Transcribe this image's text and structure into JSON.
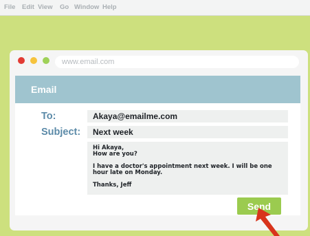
{
  "menubar": {
    "items": [
      "File",
      "Edit",
      "View",
      "Go",
      "Window",
      "Help"
    ]
  },
  "browser": {
    "url": "www.email.com"
  },
  "email": {
    "header_title": "Email",
    "to_label": "To:",
    "to_value": "Akaya@emailme.com",
    "subject_label": "Subject:",
    "subject_value": "Next week",
    "body": "Hi Akaya,\nHow are you?\n\nI have a doctor's appointment next week. I will be one hour late on Monday.\n\nThanks, Jeff",
    "send_label": "Send"
  },
  "colors": {
    "background": "#cde07e",
    "header": "#9fc4cf",
    "label": "#5b8aa8",
    "send_button": "#9bcb4f",
    "arrow": "#d8341c"
  },
  "icons": {
    "close": "close-dot-icon",
    "minimize": "minimize-dot-icon",
    "maximize": "maximize-dot-icon",
    "pointer": "arrow-pointer-icon"
  }
}
